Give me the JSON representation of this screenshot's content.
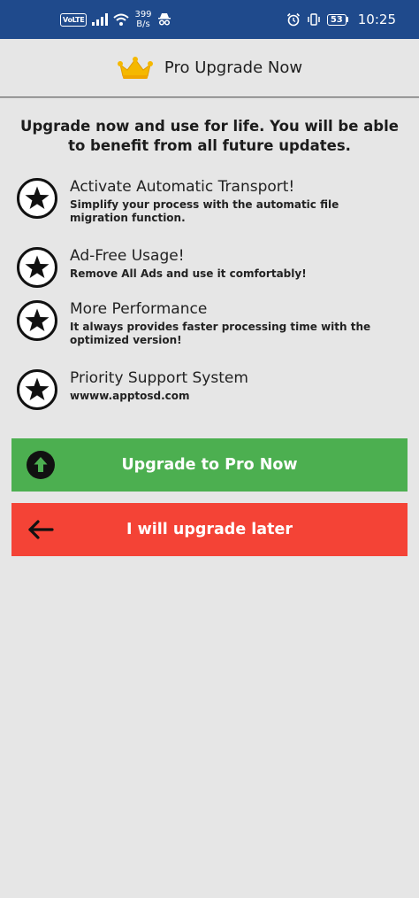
{
  "status_bar": {
    "network_badge": "VoLTE",
    "speed_value": "399",
    "speed_unit": "B/s",
    "battery": "53",
    "time": "10:25",
    "background": "#1f4a8c"
  },
  "header": {
    "title": "Pro Upgrade Now",
    "icon": "crown-icon"
  },
  "intro": "Upgrade now and use for life. You will be able to benefit from all future updates.",
  "features": [
    {
      "icon": "star-icon",
      "title": "Activate Automatic Transport!",
      "desc": "Simplify your process with the automatic file migration function."
    },
    {
      "icon": "star-icon",
      "title": "Ad-Free Usage!",
      "desc": "Remove All Ads and use it comfortably!"
    },
    {
      "icon": "star-icon",
      "title": "More Performance",
      "desc": "It always provides faster processing time with the optimized version!"
    },
    {
      "icon": "star-icon",
      "title": "Priority Support System",
      "desc": "wwww.apptosd.com"
    }
  ],
  "buttons": {
    "upgrade": {
      "label": "Upgrade to Pro Now",
      "icon": "arrow-up-circle-icon",
      "color": "#4caf50"
    },
    "later": {
      "label": "I will upgrade later",
      "icon": "arrow-left-icon",
      "color": "#f44336"
    }
  }
}
